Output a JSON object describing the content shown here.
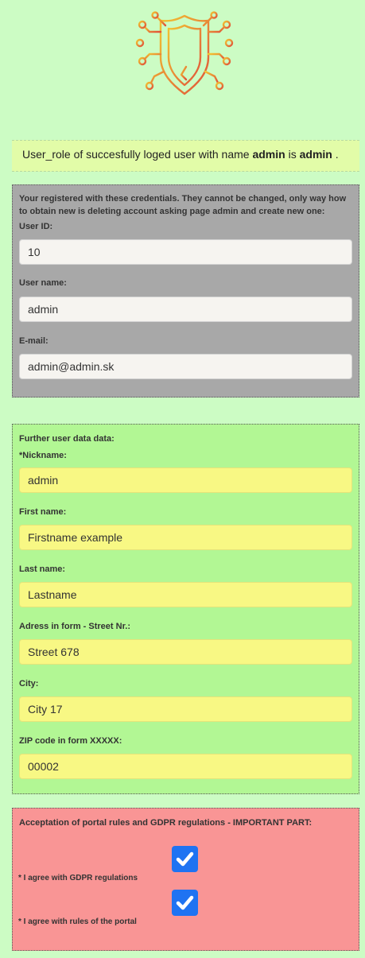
{
  "logo": {
    "icon": "shield-circuit-icon"
  },
  "role_message": {
    "prefix": "User_role of succesfully loged user with name",
    "username": "admin",
    "middle": "is",
    "role": "admin",
    "suffix": "."
  },
  "credentials": {
    "description": "Your registered with these credentials. They cannot be changed, only way how to obtain new is deleting account asking page admin and create new one:",
    "user_id_label": "User ID:",
    "user_id_value": "10",
    "user_name_label": "User name:",
    "user_name_value": "admin",
    "email_label": "E-mail:",
    "email_value": "admin@admin.sk"
  },
  "further": {
    "heading": "Further user data data:",
    "nickname_label": "*Nickname:",
    "nickname_value": "admin",
    "first_name_label": "First name:",
    "first_name_value": "Firstname example",
    "last_name_label": "Last name:",
    "last_name_value": "Lastname",
    "address_label": "Adress in form - Street Nr.:",
    "address_value": "Street 678",
    "city_label": "City:",
    "city_value": "City 17",
    "zip_label": "ZIP code in form XXXXX:",
    "zip_value": "00002"
  },
  "acceptance": {
    "heading": "Acceptation of portal rules and GDPR regulations - IMPORTANT PART:",
    "gdpr_label": "* I agree with GDPR regulations",
    "gdpr_checked": true,
    "rules_label": "* I agree with rules of the portal",
    "rules_checked": true
  },
  "colors": {
    "page_bg": "#ccfcc4",
    "role_bar_bg": "#e2fca8",
    "credentials_bg": "#a8a8a8",
    "further_bg": "#b2f794",
    "acceptance_bg": "#f99595",
    "checkbox": "#1f73f2",
    "logo_gradient_start": "#f0c030",
    "logo_gradient_end": "#e05a3a"
  }
}
